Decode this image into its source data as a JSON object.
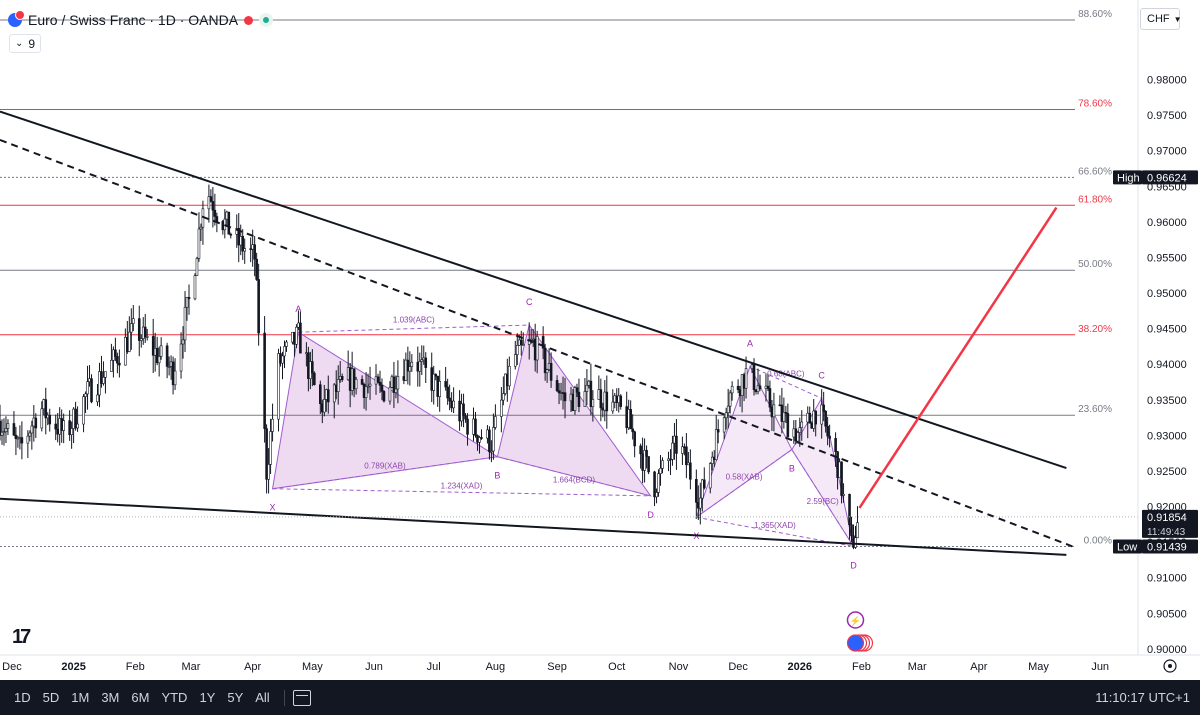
{
  "header": {
    "title": "Euro / Swiss Franc · 1D · OANDA",
    "indicator_count": "9"
  },
  "price_axis": {
    "currency": "CHF",
    "ticks": [
      "0.98000",
      "0.97500",
      "0.97000",
      "0.96500",
      "0.96000",
      "0.95500",
      "0.95000",
      "0.94500",
      "0.94000",
      "0.93500",
      "0.93000",
      "0.92500",
      "0.92000",
      "0.91500",
      "0.91000",
      "0.90500",
      "0.90000"
    ],
    "high_label": "High",
    "high_value": "0.96624",
    "last_value": "0.91854",
    "countdown": "11:49:43",
    "low_label": "Low",
    "low_value": "0.91439"
  },
  "time_axis": {
    "ticks": [
      "Dec",
      "2025",
      "Feb",
      "Mar",
      "Apr",
      "May",
      "Jun",
      "Jul",
      "Aug",
      "Sep",
      "Oct",
      "Nov",
      "Dec",
      "2026",
      "Feb",
      "Mar",
      "Apr",
      "May",
      "Jun"
    ]
  },
  "bottom_bar": {
    "timeframes": [
      "1D",
      "5D",
      "1M",
      "3M",
      "6M",
      "YTD",
      "1Y",
      "5Y",
      "All"
    ],
    "clock": "11:10:17 UTC+1"
  },
  "colors": {
    "candle": "#131722",
    "fib_red": "#f23645",
    "fib_gray": "#787b86",
    "pattern_fill": "#9c27b0",
    "projection": "#f23645"
  },
  "chart_data": {
    "type": "candlestick",
    "instrument": "EUR/CHF",
    "timeframe": "1D",
    "ylim": [
      0.8997,
      0.9885
    ],
    "x_range": [
      "2024-11-25",
      "2026-06-20"
    ],
    "fib_levels": [
      {
        "label": "88.60%",
        "price": 0.98836
      },
      {
        "label": "78.60%",
        "price": 0.97578
      },
      {
        "label": "66.60%",
        "price": 0.96624
      },
      {
        "label": "61.80%",
        "price": 0.96233
      },
      {
        "label": "50.00%",
        "price": 0.9532
      },
      {
        "label": "38.20%",
        "price": 0.94413
      },
      {
        "label": "23.60%",
        "price": 0.93283
      },
      {
        "label": "0.00%",
        "price": 0.91439
      }
    ],
    "price_path": [
      [
        "2024-11-25",
        0.932
      ],
      [
        "2024-12-05",
        0.928
      ],
      [
        "2024-12-15",
        0.934
      ],
      [
        "2024-12-28",
        0.93
      ],
      [
        "2025-01-08",
        0.936
      ],
      [
        "2025-01-20",
        0.94
      ],
      [
        "2025-02-01",
        0.945
      ],
      [
        "2025-02-10",
        0.942
      ],
      [
        "2025-02-20",
        0.939
      ],
      [
        "2025-03-01",
        0.95
      ],
      [
        "2025-03-08",
        0.965
      ],
      [
        "2025-03-15",
        0.961
      ],
      [
        "2025-03-25",
        0.957
      ],
      [
        "2025-04-02",
        0.955
      ],
      [
        "2025-04-08",
        0.925
      ],
      [
        "2025-04-14",
        0.94
      ],
      [
        "2025-04-24",
        0.944
      ],
      [
        "2025-05-05",
        0.934
      ],
      [
        "2025-05-20",
        0.938
      ],
      [
        "2025-06-05",
        0.936
      ],
      [
        "2025-06-20",
        0.941
      ],
      [
        "2025-07-05",
        0.936
      ],
      [
        "2025-07-20",
        0.931
      ],
      [
        "2025-07-30",
        0.929
      ],
      [
        "2025-08-10",
        0.941
      ],
      [
        "2025-08-20",
        0.943
      ],
      [
        "2025-09-05",
        0.935
      ],
      [
        "2025-09-20",
        0.936
      ],
      [
        "2025-10-05",
        0.933
      ],
      [
        "2025-10-20",
        0.923
      ],
      [
        "2025-11-01",
        0.929
      ],
      [
        "2025-11-12",
        0.921
      ],
      [
        "2025-11-25",
        0.935
      ],
      [
        "2025-12-06",
        0.939
      ],
      [
        "2025-12-18",
        0.934
      ],
      [
        "2026-01-01",
        0.93
      ],
      [
        "2026-01-10",
        0.934
      ],
      [
        "2026-01-20",
        0.926
      ],
      [
        "2026-01-27",
        0.9144
      ],
      [
        "2026-01-31",
        0.9185
      ]
    ],
    "patterns": [
      {
        "name": "XABCD 1",
        "points": [
          [
            "X",
            "2025-04-11",
            0.9225
          ],
          [
            "A",
            "2025-04-24",
            0.9445
          ],
          [
            "B",
            "2025-08-02",
            0.927
          ],
          [
            "C",
            "2025-08-18",
            0.9455
          ],
          [
            "D",
            "2025-10-18",
            0.9215
          ]
        ],
        "ratios": [
          "1.039(ABC)",
          "0.789(XAB)",
          "1.664(BCD)",
          "1.234(XAD)"
        ]
      },
      {
        "name": "XABCD 2",
        "points": [
          [
            "X",
            "2025-11-10",
            0.9185
          ],
          [
            "A",
            "2025-12-07",
            0.9397
          ],
          [
            "B",
            "2025-12-28",
            0.928
          ],
          [
            "C",
            "2026-01-12",
            0.9352
          ],
          [
            "D",
            "2026-01-28",
            0.9144
          ]
        ],
        "ratios": [
          "0.68(ABC)",
          "0.58(XAB)",
          "2.59(BC)",
          "1.365(XAD)"
        ]
      }
    ],
    "trendlines": [
      {
        "style": "solid",
        "from": [
          "2024-11-25",
          0.9755
        ],
        "to": [
          "2026-05-15",
          0.9254
        ]
      },
      {
        "style": "solid",
        "from": [
          "2024-11-25",
          0.9211
        ],
        "to": [
          "2026-05-15",
          0.9132
        ]
      },
      {
        "style": "dashed",
        "from": [
          "2024-11-25",
          0.9715
        ],
        "to": [
          "2026-05-18",
          0.9144
        ]
      }
    ],
    "projection": {
      "from": [
        "2026-01-31",
        0.9198
      ],
      "to": [
        "2026-05-10",
        0.962
      ]
    }
  }
}
